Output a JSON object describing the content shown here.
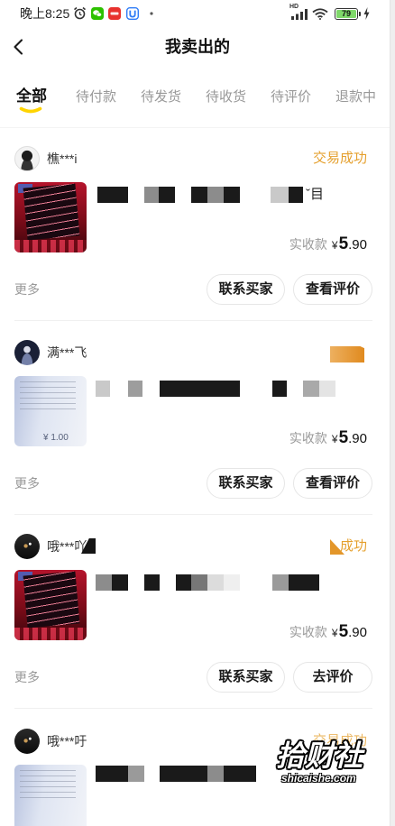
{
  "status_bar": {
    "time": "晚上8:25",
    "network": "HD",
    "battery": "79",
    "left_icons": [
      "alarm-clock-icon",
      "wechat-icon",
      "red-app-icon",
      "blue-app-icon",
      "dot-icon"
    ],
    "right_icons": [
      "signal-icon",
      "wifi-icon",
      "battery-icon",
      "charging-icon"
    ]
  },
  "header": {
    "back_icon": "chevron-left-icon",
    "title": "我卖出的"
  },
  "tabs": [
    {
      "label": "全部",
      "active": true
    },
    {
      "label": "待付款",
      "active": false
    },
    {
      "label": "待发货",
      "active": false
    },
    {
      "label": "待收货",
      "active": false
    },
    {
      "label": "待评价",
      "active": false
    },
    {
      "label": "退款中",
      "active": false
    }
  ],
  "orders": [
    {
      "buyer": "樵***i",
      "status": "交易成功",
      "title_tail": "ˇ目",
      "price_label": "实收款",
      "currency": "¥",
      "amount_int": "5",
      "amount_dec": ".90",
      "more_label": "更多",
      "actions": [
        "联系买家",
        "查看评价"
      ]
    },
    {
      "buyer": "满***飞",
      "thumbnail_text": "¥ 1.00",
      "price_label": "实收款",
      "currency": "¥",
      "amount_int": "5",
      "amount_dec": ".90",
      "more_label": "更多",
      "actions": [
        "联系买家",
        "查看评价"
      ]
    },
    {
      "buyer": "哦***吖",
      "status": "成功",
      "price_label": "实收款",
      "currency": "¥",
      "amount_int": "5",
      "amount_dec": ".90",
      "more_label": "更多",
      "actions": [
        "联系买家",
        "去评价"
      ]
    },
    {
      "buyer": "哦***吁",
      "status": "交易成功"
    }
  ],
  "watermark": {
    "brand": "拾财社",
    "url": "shicaishe.com"
  },
  "colors": {
    "accent_yellow": "#FFD400",
    "status_orange": "#E5A02E",
    "text_primary": "#222222",
    "text_secondary": "#999999",
    "divider": "#F0F0F0",
    "button_border": "#E6E6E6"
  }
}
